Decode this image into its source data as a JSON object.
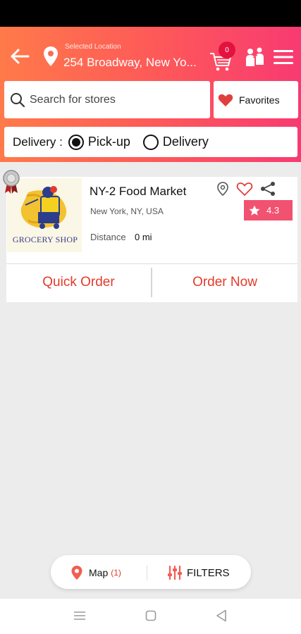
{
  "header": {
    "location_caption": "Selected Location",
    "location_value": "254 Broadway, New Yo...",
    "cart_count": "0"
  },
  "search": {
    "placeholder": "Search for stores"
  },
  "favorites": {
    "label": "Favorites"
  },
  "delivery": {
    "label": "Delivery :",
    "options": [
      {
        "label": "Pick-up",
        "selected": true
      },
      {
        "label": "Delivery",
        "selected": false
      }
    ]
  },
  "store": {
    "logo_text": "GROCERY SHOP",
    "name": "NY-2 Food Market",
    "address": "New York, NY, USA",
    "distance_label": "Distance",
    "distance_value": "0 mi",
    "rating": "4.3",
    "quick_order_label": "Quick Order",
    "order_now_label": "Order Now"
  },
  "bottom_bar": {
    "map_label": "Map",
    "map_count": "(1)",
    "filters_label": "FILTERS"
  },
  "colors": {
    "header_gradient_start": "#ff7a4a",
    "header_gradient_end": "#f83a72",
    "accent_red": "#e43a2a",
    "rating_badge": "#f05270"
  },
  "icons": [
    "back-arrow-icon",
    "location-pin-icon",
    "cart-icon",
    "people-icon",
    "menu-icon",
    "search-icon",
    "heart-icon",
    "medal-icon",
    "map-pin-icon",
    "share-icon",
    "star-icon",
    "filters-icon"
  ]
}
